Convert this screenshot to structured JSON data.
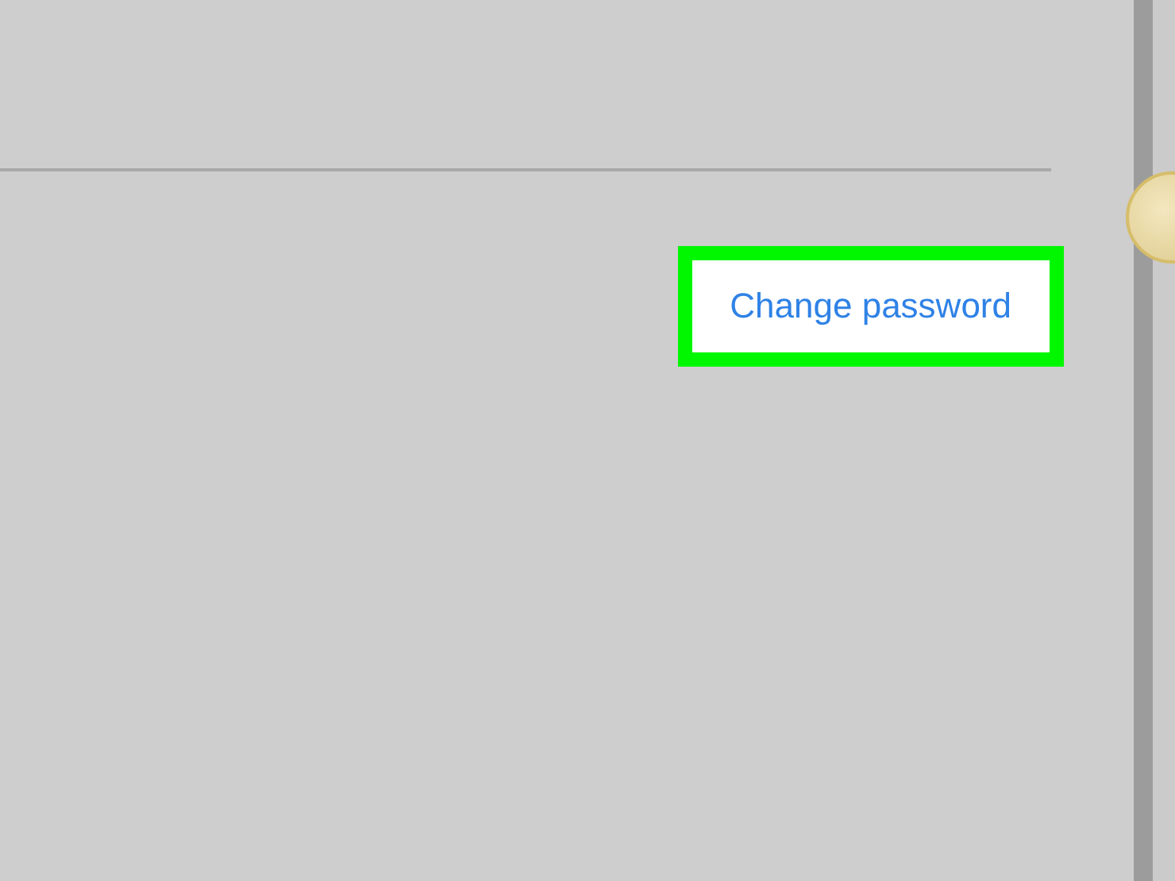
{
  "link": {
    "label": "Change password",
    "highlighted": true
  }
}
